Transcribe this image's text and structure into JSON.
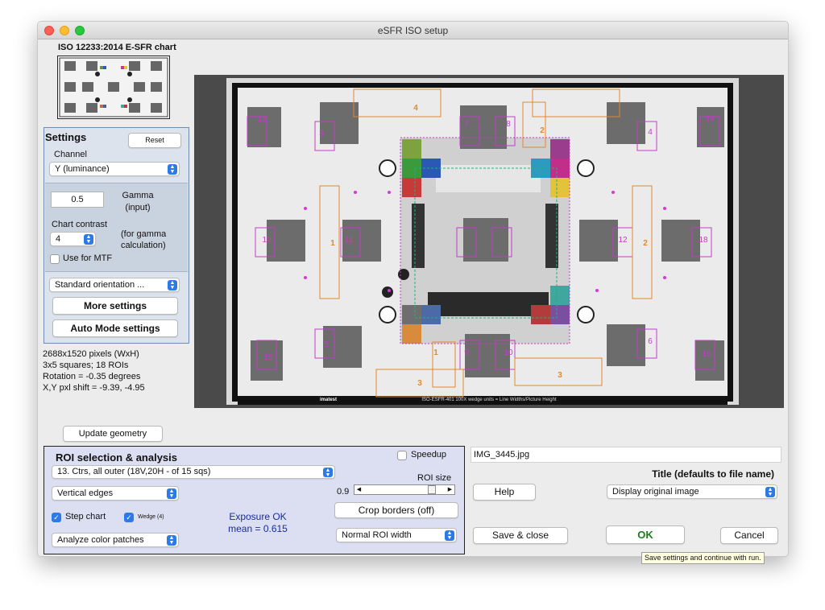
{
  "window": {
    "title": "eSFR ISO setup"
  },
  "thumbnail": {
    "title": "ISO 12233:2014 E-SFR chart"
  },
  "settings": {
    "title": "Settings",
    "reset_label": "Reset",
    "channel_label": "Channel",
    "channel_value": "Y (luminance)",
    "gamma_value": "0.5",
    "gamma_label_1": "Gamma",
    "gamma_label_2": "(input)",
    "contrast_label": "Chart contrast",
    "contrast_value": "4",
    "contrast_note_1": "(for gamma",
    "contrast_note_2": "calculation)",
    "use_for_mtf": "Use for MTF",
    "orientation_value": "Standard orientation     ...",
    "more_settings": "More settings",
    "auto_mode": "Auto Mode settings"
  },
  "info": {
    "pixels": "2688x1520 pixels (WxH)",
    "squares": "3x5 squares; 18 ROIs",
    "rotation": "Rotation = -0.35 degrees",
    "shift": "X,Y pxl shift = -9.39, -4.95"
  },
  "image_labels": {
    "footer": "ISO-ESFR-401 100X wedge units = Line Widths/Picture Height",
    "logo": "imatest"
  },
  "update_geometry": "Update geometry",
  "roi": {
    "title": "ROI selection & analysis",
    "speedup": "Speedup",
    "selection_value": "13. Ctrs, all outer (18V,20H - of 15 sqs)",
    "roi_size_label": "ROI size",
    "roi_size_value": "0.9",
    "roi_size_fraction": 0.78,
    "edges_value": "Vertical edges",
    "crop_borders": "Crop borders  (off)",
    "step_chart": "Step chart",
    "wedge": "Wedge (4)",
    "exposure": "Exposure OK",
    "mean": "mean = 0.615",
    "color_patches_value": "Analyze color patches",
    "roi_width_value": "Normal ROI width"
  },
  "right": {
    "filename": "IMG_3445.jpg",
    "title_label": "Title (defaults to file name)",
    "help": "Help",
    "display_value": "Display original image",
    "save_close": "Save & close",
    "ok": "OK",
    "cancel": "Cancel",
    "tooltip": "Save settings and continue with run."
  },
  "roi_numbers": [
    "13",
    "3",
    "7",
    "8",
    "4",
    "14",
    "4",
    "2",
    "10",
    "11",
    "1",
    "12",
    "2",
    "18",
    "15",
    "5",
    "9",
    "10",
    "1",
    "3",
    "3",
    "6",
    "16"
  ],
  "colors": {
    "accent": "#2c79e8",
    "ok_text": "#1d7a1d",
    "roi_magenta": "#c23cc8",
    "roi_orange": "#e08a2a"
  }
}
